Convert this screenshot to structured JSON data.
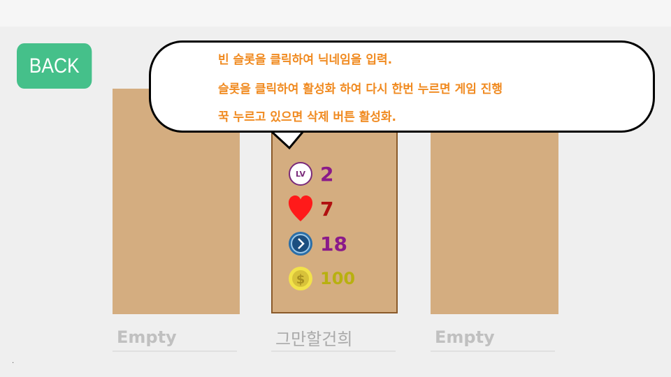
{
  "back_button": {
    "label": "BACK"
  },
  "tooltip": {
    "lines": [
      "빈 슬롯을 클릭하여 닉네임을 입력.",
      "슬롯을 클릭하여 활성화 하여 다시 한번 누르면 게임 진행",
      " 꾹 누르고 있으면 삭제 버튼 활성화."
    ]
  },
  "slots": [
    {
      "name": "Empty"
    },
    {
      "name": "그만할건희",
      "stats": {
        "level_icon_text": "LV",
        "level": "2",
        "hearts": "7",
        "energy": "18",
        "coins": "100"
      }
    },
    {
      "name": "Empty"
    }
  ],
  "colors": {
    "back_button": "#45c08a",
    "slot": "#d4ad80",
    "tooltip_text": "#f08a20",
    "level_value": "#8a1a8a",
    "hearts_value": "#b01010",
    "energy_value": "#8a1a8a",
    "coins_value": "#b8b010"
  },
  "footer": {
    "dot": "."
  }
}
